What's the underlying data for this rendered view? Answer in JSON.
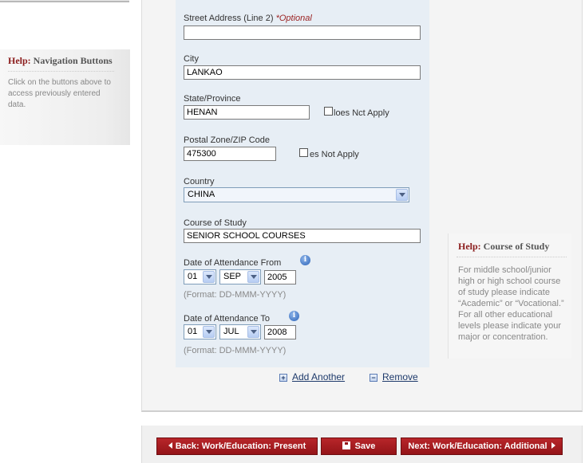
{
  "sidebar": {
    "help_nav": {
      "help_word": "Help:",
      "title": "Navigation Buttons",
      "text": "Click on the buttons above to access previously entered data."
    }
  },
  "form": {
    "street2": {
      "label": "Street Address (Line 2)",
      "optional": "*Optional",
      "value": ""
    },
    "city": {
      "label": "City",
      "value": "LANKAO"
    },
    "state": {
      "label": "State/Province",
      "value": "HENAN",
      "dna_label": "loes Nct Apply"
    },
    "postal": {
      "label": "Postal Zone/ZIP Code",
      "value": "475300",
      "dna_label": "es Not Apply"
    },
    "country": {
      "label": "Country",
      "value": "CHINA"
    },
    "course": {
      "label": "Course of Study",
      "value": "SENIOR SCHOOL COURSES"
    },
    "from": {
      "label": "Date of Attendance From",
      "day": "01",
      "month": "SEP",
      "year": "2005",
      "format": "(Format: DD-MMM-YYYY)"
    },
    "to": {
      "label": "Date of Attendance To",
      "day": "01",
      "month": "JUL",
      "year": "2008",
      "format": "(Format: DD-MMM-YYYY)"
    },
    "add_another": "Add Another",
    "remove": "Remove"
  },
  "help_course": {
    "help_word": "Help:",
    "title": "Course of Study",
    "text": "For middle school/junior high or high school course of study please indicate “Academic” or “Vocational.” For all other educational levels please indicate your major or concentration."
  },
  "buttons": {
    "back": "Back: Work/Education: Present",
    "save": "Save",
    "next": "Next: Work/Education: Additional"
  },
  "icons": {
    "info": "info-icon",
    "dropdown": "chevron-down-icon",
    "add": "plus-icon",
    "remove": "minus-icon",
    "save": "floppy-disk-icon"
  },
  "colors": {
    "accent_red": "#a81d21",
    "form_bg": "#e7eef5",
    "help_red": "#8b1c1c"
  }
}
